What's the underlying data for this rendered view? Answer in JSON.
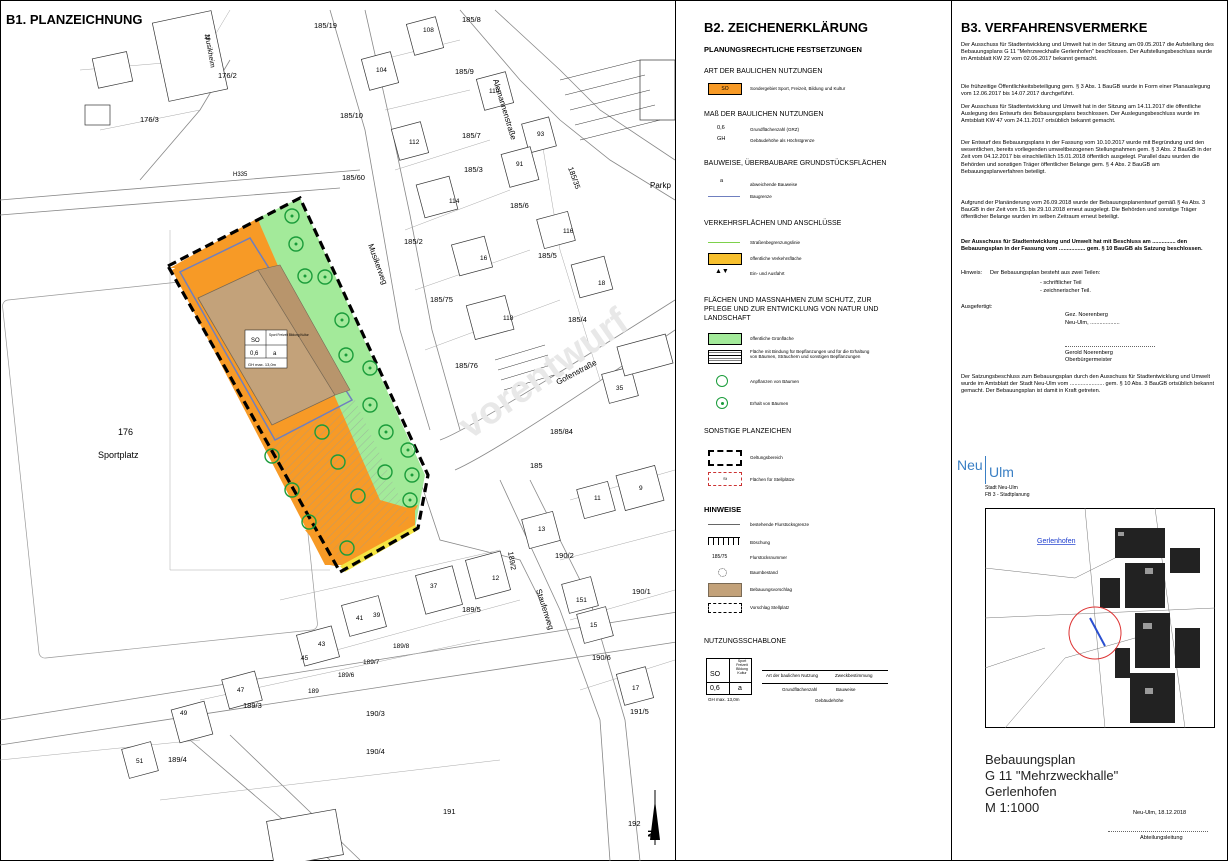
{
  "plan": {
    "heading": "B1. PLANZEICHNUNG",
    "street_labels": [
      "Alemannenstraße",
      "Musikerweg",
      "Gofenstraße",
      "Staufenweg",
      "Musikheim",
      "Parkp"
    ],
    "area_labels": {
      "sportplatz": "Sportplatz",
      "plot_176": "176"
    },
    "parcel_labels": [
      "185/19",
      "185/8",
      "185/9",
      "185/10",
      "185/7",
      "185/3",
      "185/60",
      "185/6",
      "185/2",
      "185/5",
      "185/75",
      "185/4",
      "185/76",
      "185/84",
      "185",
      "185/35",
      "176/2",
      "176/3",
      "H335",
      "189/2",
      "189/5",
      "189/8",
      "189/7",
      "189/6",
      "189",
      "189/3",
      "189/4",
      "190/2",
      "190/1",
      "190/6",
      "190/3",
      "190/4",
      "191",
      "191/5",
      "192"
    ],
    "house_numbers": [
      "11",
      "108",
      "104",
      "110",
      "112",
      "93",
      "91",
      "114",
      "116",
      "16",
      "118",
      "18",
      "35",
      "9",
      "11",
      "13",
      "15",
      "151",
      "17",
      "12",
      "37",
      "41",
      "39",
      "43",
      "45",
      "47",
      "49",
      "51"
    ],
    "schablone": {
      "zone": "SO",
      "grz": "0,6",
      "bauweise": "a",
      "gh": "GH max. 13,0m",
      "zweck": "Sport Freizeit Bildung Kultur"
    },
    "north_label": "N",
    "watermark": "vorentwurf"
  },
  "legend": {
    "heading": "B2. ZEICHENERKLÄRUNG",
    "subheading": "PLANUNGSRECHTLICHE FESTSETZUNGEN",
    "sections": [
      {
        "title": "ART DER BAULICHEN NUTZUNGEN",
        "items": [
          {
            "symbol": "SO",
            "text": "Sondergebiet Sport, Freizeit, Bildung und Kultur"
          }
        ]
      },
      {
        "title": "MAß DER BAULICHEN NUTZUNGEN",
        "items": [
          {
            "symbol": "0,6",
            "text": "Grundflächenzahl (GRZ)"
          },
          {
            "symbol": "GH",
            "text": "Gebäudehöhe als Höchstgrenze"
          }
        ]
      },
      {
        "title": "BAUWEISE, ÜBERBAUBARE GRUNDSTÜCKSFLÄCHEN",
        "items": [
          {
            "symbol": "a",
            "text": "abweichende Bauweise"
          },
          {
            "symbol": "",
            "text": "Baugrenze"
          }
        ]
      },
      {
        "title": "VERKEHRSFLÄCHEN UND ANSCHLÜSSE",
        "items": [
          {
            "text": "Straßenbegrenzungslinie"
          },
          {
            "text": "öffentliche Verkehrsfläche"
          },
          {
            "text": "Ein- und Ausfahrt"
          }
        ]
      },
      {
        "title": "FLÄCHEN UND MASSNAHMEN ZUM SCHUTZ, ZUR PFLEGE UND ZUR ENTWICKLUNG VON NATUR UND LANDSCHAFT",
        "items": [
          {
            "text": "öffentliche Grünfläche"
          },
          {
            "text": "Fläche mit Bindung für Bepflanzungen und für die Erhaltung von Bäumen, Sträuchern und sonstigen Bepflanzungen"
          },
          {
            "text": "Anpflanzen von Bäumen"
          },
          {
            "text": "Erhalt von Bäumen"
          }
        ]
      },
      {
        "title": "SONSTIGE PLANZEICHEN",
        "items": [
          {
            "text": "Geltungsbereich"
          },
          {
            "symbol": "St",
            "text": "Flächen für Stellplätze"
          }
        ]
      },
      {
        "title": "HINWEISE",
        "items": [
          {
            "text": "bestehende Flurstücksgrenze"
          },
          {
            "text": "Böschung"
          },
          {
            "symbol": "185/75",
            "text": "Flurstücksnummer"
          },
          {
            "text": "Baumbestand"
          },
          {
            "text": "Bebauungsvorschlag"
          },
          {
            "text": "Vorschlag Stellplatz"
          }
        ]
      }
    ],
    "nutzungsschablone": {
      "title": "NUTZUNGSSCHABLONE",
      "zone": "SO",
      "zweck": "Sport Freizeit Bildung Kultur",
      "grz": "0,6",
      "bauweise": "a",
      "gh": "GH max. 13,0m",
      "desc_art": "Art der baulichen Nutzung",
      "desc_zweck": "Zweckbestimmung",
      "desc_grz": "Grundflächenzahl",
      "desc_bauweise": "Bauweise",
      "desc_gh": "Gebäudehöhe"
    }
  },
  "vermerke": {
    "heading": "B3. VERFAHRENSVERMERKE",
    "paragraphs": [
      "Der Ausschuss für Stadtentwicklung und Umwelt hat in der Sitzung am 09.05.2017 die Aufstellung des Bebauungsplans G 11 \"Mehrzweckhalle Gerlenhofen\" beschlossen. Der Aufstellungsbeschluss wurde im Amtsblatt KW 22 vom 02.06.2017 bekannt gemacht.",
      "Die frühzeitige Öffentlichkeitsbeteiligung gem. § 3 Abs. 1 BauGB wurde in Form einer Planauslegung vom 12.06.2017 bis 14.07.2017 durchgeführt.",
      "Der Ausschuss für Stadtentwicklung und Umwelt hat in der Sitzung am 14.11.2017 die öffentliche Auslegung des Entwurfs des Bebauungsplans beschlossen. Der Auslegungsbeschluss wurde im Amtsblatt KW 47 vom 24.11.2017 ortsüblich bekannt gemacht.",
      "Der Entwurf des Bebauungsplans in der Fassung vom 10.10.2017 wurde mit Begründung und den wesentlichen, bereits vorliegenden umweltbezogenen Stellungnahmen gem. § 3 Abs. 2 BauGB in der Zeit vom 04.12.2017 bis einschließlich 15.01.2018 öffentlich ausgelegt. Parallel dazu wurden die Behörden und sonstigen Träger öffentlicher Belange gem. § 4 Abs. 2 BauGB am Bebauungsplanverfahren beteiligt.",
      "Aufgrund der Planänderung vom 26.09.2018 wurde der Bebauungsplanentwurf gemäß § 4a Abs. 3 BauGB in der Zeit vom 15. bis 29.10.2018 erneut ausgelegt. Die Behörden und sonstige Träger öffentlicher Belange wurden im selben Zeitraum erneut beteiligt."
    ],
    "satzung_bold": "Der Ausschuss für Stadtentwicklung und Umwelt hat mit Beschluss am ............... den Bebauungsplan in der Fassung vom ................. gem. § 10 BauGB als Satzung beschlossen.",
    "hinweis_label": "Hinweis:",
    "hinweis_text": "Der Bebauungsplan besteht aus zwei Teilen:",
    "hinweis_items": [
      "- schriftlicher Teil",
      "- zeichnerischer Teil."
    ],
    "ausgefertigt": "Ausgefertigt:",
    "gez": "Gez. Noerenberg",
    "ort_datum": "Neu-Ulm, ...................",
    "signer_name": "Gerold Noerenberg",
    "signer_role": "Oberbürgermeister",
    "bekanntmachung": "Der Satzungsbeschluss zum Bebauungsplan durch den Ausschuss für Stadtentwicklung und Umwelt wurde im Amtsblatt der Stadt Neu-Ulm vom ...................... gem. § 10 Abs. 3 BauGB ortsüblich bekannt gemacht. Der Bebauungsplan ist damit in Kraft getreten.",
    "logo_neu": "Neu",
    "logo_ulm": "Ulm",
    "office_line1": "Stadt Neu-Ulm",
    "office_line2": "FB 3 - Stadtplanung",
    "overview_label": "Gerlenhofen",
    "title_lines": [
      "Bebauungsplan",
      "G 11 \"Mehrzweckhalle\"",
      "Gerlenhofen",
      "M 1:1000"
    ],
    "date": "Neu-Ulm, 18.12.2018",
    "abteilungsleitung": "Abteilungsleitung"
  }
}
